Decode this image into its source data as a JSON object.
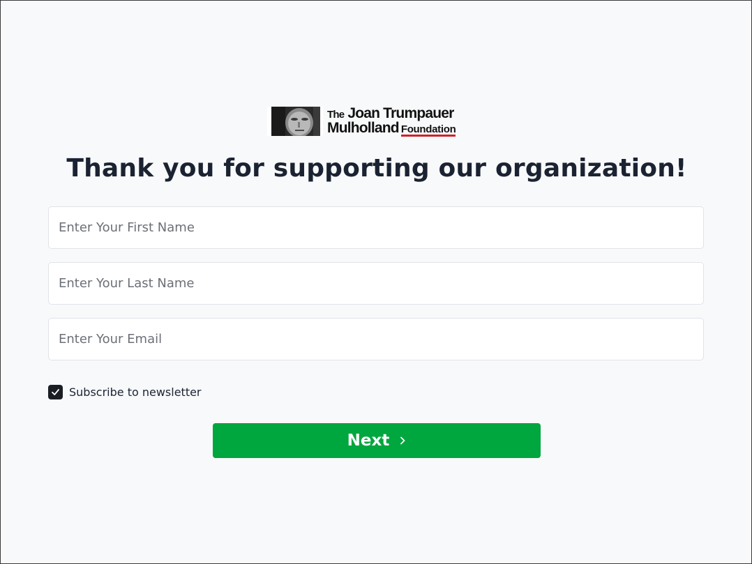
{
  "logo": {
    "line1_the": "The",
    "line1_rest": "Joan Trumpauer",
    "line2_main": "Mulholland",
    "line2_sub": "Foundation",
    "accent_color": "#d0202a"
  },
  "title": "Thank you for supporting our organization!",
  "form": {
    "first_name": {
      "placeholder": "Enter Your First Name",
      "value": ""
    },
    "last_name": {
      "placeholder": "Enter Your Last Name",
      "value": ""
    },
    "email": {
      "placeholder": "Enter Your Email",
      "value": ""
    },
    "newsletter": {
      "label": "Subscribe to newsletter",
      "checked": true
    },
    "next_label": "Next",
    "next_icon": "chevron-right-icon",
    "next_color": "#00a63e"
  }
}
